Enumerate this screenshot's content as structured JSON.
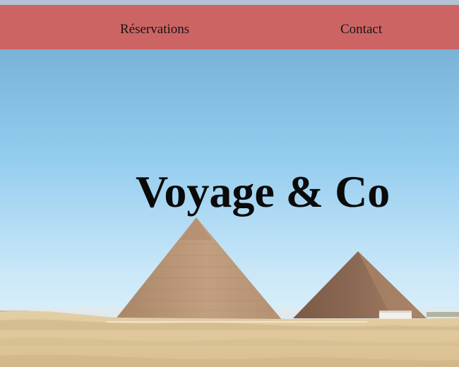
{
  "nav": {
    "items": [
      {
        "label": "Réservations"
      },
      {
        "label": "Contact"
      }
    ]
  },
  "hero": {
    "title": "Voyage & Co",
    "image": "pyramids-desert-photo"
  },
  "colors": {
    "navbar": "#cd6464",
    "top_strip": "#b4c3d3",
    "title": "#0a0a0a",
    "sky_top": "#78b4dc",
    "sky_bottom": "#e6f4fc",
    "sand": "#e8d3a8",
    "pyramid": "#b49274"
  }
}
